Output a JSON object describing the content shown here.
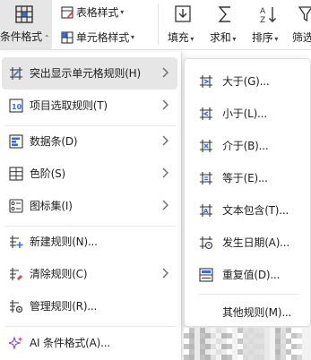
{
  "ribbon": {
    "conditional_format": "条件格式",
    "table_style": "表格样式",
    "cell_style": "单元格样式",
    "fill": "填充",
    "sum": "求和",
    "sort": "排序",
    "filter": "筛选"
  },
  "menu": {
    "items": [
      {
        "label": "突出显示单元格规则(H)",
        "icon": "highlight-cells-icon",
        "submenu": true,
        "active": true
      },
      {
        "label": "项目选取规则(T)",
        "icon": "top-bottom-icon",
        "submenu": true
      },
      {
        "label": "数据条(D)",
        "icon": "data-bar-icon",
        "submenu": true
      },
      {
        "label": "色阶(S)",
        "icon": "color-scale-icon",
        "submenu": true
      },
      {
        "label": "图标集(I)",
        "icon": "icon-set-icon",
        "submenu": true
      },
      {
        "label": "新建规则(N)...",
        "icon": "new-rule-icon",
        "submenu": false
      },
      {
        "label": "清除规则(C)",
        "icon": "clear-rule-icon",
        "submenu": true
      },
      {
        "label": "管理规则(R)...",
        "icon": "manage-rule-icon",
        "submenu": false
      },
      {
        "label": "AI 条件格式(A)...",
        "icon": "ai-sparkle-icon",
        "submenu": false
      }
    ]
  },
  "submenu": {
    "items": [
      {
        "label": "大于(G)...",
        "icon": "greater-than-icon"
      },
      {
        "label": "小于(L)...",
        "icon": "less-than-icon"
      },
      {
        "label": "介于(B)...",
        "icon": "between-icon"
      },
      {
        "label": "等于(E)...",
        "icon": "equal-to-icon"
      },
      {
        "label": "文本包含(T)...",
        "icon": "text-contains-icon"
      },
      {
        "label": "发生日期(A)...",
        "icon": "date-occurring-icon"
      },
      {
        "label": "重复值(D)...",
        "icon": "duplicate-values-icon"
      },
      {
        "label": "其他规则(M)...",
        "icon": ""
      }
    ]
  },
  "colors": {
    "accent": "#2e6be6",
    "hover": "#e6e6e6",
    "icon_red": "#e0443a"
  }
}
